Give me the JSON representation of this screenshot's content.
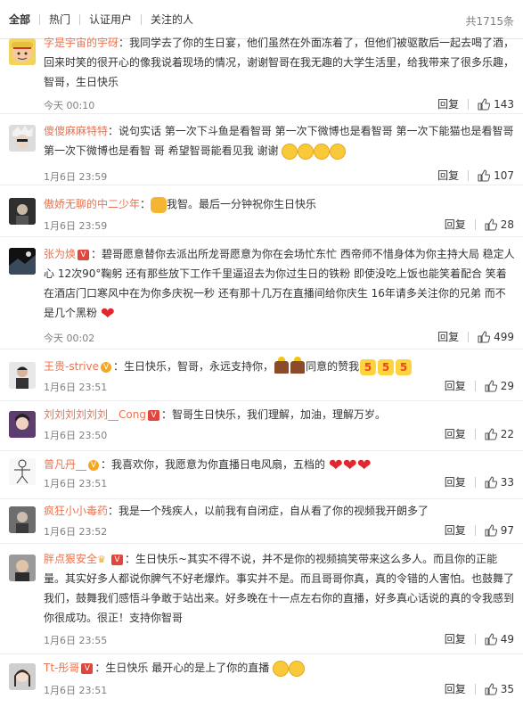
{
  "tabs": {
    "all": "全部",
    "hot": "热门",
    "verified": "认证用户",
    "following": "关注的人",
    "total": "共1715条"
  },
  "colors": {
    "username": "#eb7350",
    "meta": "#808080"
  },
  "comments": [
    {
      "username": "字是宇宙的宇砑",
      "text": "：我同学去了你的生日宴，他们虽然在外面冻着了，但他们被驱散后一起去喝了酒，回来时笑的很开心的像我说着现场的情况，谢谢智哥在我无趣的大学生活里，给我带来了很多乐趣，智哥，生日快乐",
      "time": "今天 00:10",
      "reply": "回复",
      "likes": "143"
    },
    {
      "username": "傻傻麻麻特特",
      "text": "：说句实话 第一次下斗鱼是看智哥 第一次下微博也是看智哥 第一次下能猫也是看智哥 第一次下微博也是看智 哥 希望智哥能看见我 谢谢",
      "time": "1月6日 23:59",
      "reply": "回复",
      "likes": "107"
    },
    {
      "username": "傲娇无聊的中二少年",
      "text_a": "：",
      "text_b": "我智。最后一分钟祝你生日快乐",
      "time": "1月6日 23:59",
      "reply": "回复",
      "likes": "28"
    },
    {
      "username": "张为焕",
      "text": "：碧哥愿意替你去派出所龙哥愿意为你在会场忙东忙 西帝师不惜身体为你主持大局 稳定人心 12次90°鞠躬 还有那些放下工作千里逼迢去为你过生日的铁粉 即使没吃上饭也能笑着配合 笑着在酒店门口寒风中在为你多庆祝一秒 还有那十几万在直播间给你庆生 16年请多关注你的兄弟 而不是几个黑粉",
      "time": "今天 00:02",
      "reply": "回复",
      "likes": "499"
    },
    {
      "username": "王贵-strive",
      "text_a": "：生日快乐，智哥，永远支持你，",
      "text_b": "同意的赞我",
      "time": "1月6日 23:51",
      "reply": "回复",
      "likes": "29"
    },
    {
      "username": "刘刘刘刘刘刘__Cong",
      "text": "：智哥生日快乐，我们理解，加油，理解万岁。",
      "time": "1月6日 23:50",
      "reply": "回复",
      "likes": "22"
    },
    {
      "username": "曾凡丹__",
      "text": "：我喜欢你，我愿意为你直播日电风扇，五档的",
      "time": "1月6日 23:51",
      "reply": "回复",
      "likes": "33"
    },
    {
      "username": "疯狂小小毒药",
      "text": "：我是一个残疾人，以前我有自闭症，自从看了你的视频我开朗多了",
      "time": "1月6日 23:52",
      "reply": "回复",
      "likes": "97"
    },
    {
      "username": "胖点狠安全",
      "text": "：生日快乐~其实不得不说，并不是你的视频搞笑带来这么多人。而且你的正能量。其实好多人都说你脾气不好老爆炸。事实并不是。而且哥哥你真，真的令错的人害怕。也鼓舞了我们，鼓舞我们感悟斗争敢于站出来。好多晚在十一点左右你的直播，好多真心话说的真的令我感到你很成功。很正！支持你智哥",
      "time": "1月6日 23:55",
      "reply": "回复",
      "likes": "49"
    },
    {
      "username": "Tt-彤哥",
      "text": "：生日快乐 最开心的是上了你的直播",
      "time": "1月6日 23:51",
      "reply": "回复",
      "likes": "35"
    }
  ]
}
